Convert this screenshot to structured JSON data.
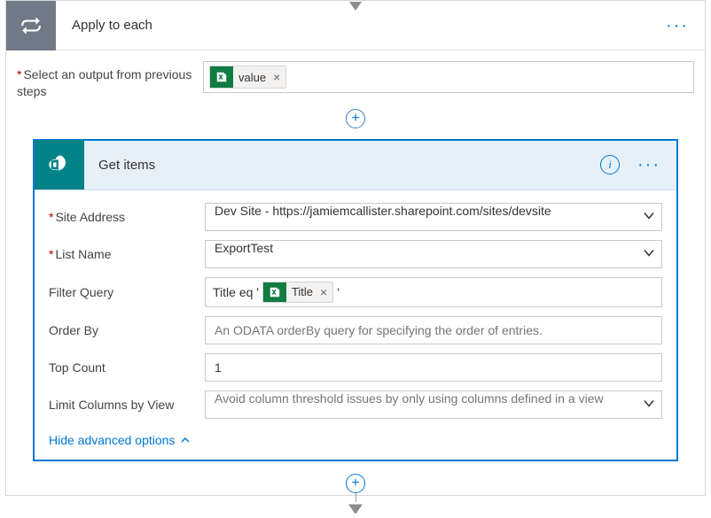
{
  "applyToEach": {
    "title": "Apply to each",
    "pickerLabel": "Select an output from previous steps",
    "token": {
      "label": "value",
      "icon": "excel"
    }
  },
  "getItems": {
    "title": "Get items",
    "fields": {
      "siteAddress": {
        "label": "Site Address",
        "value": "Dev Site - https://jamiemcallister.sharepoint.com/sites/devsite"
      },
      "listName": {
        "label": "List Name",
        "value": "ExportTest"
      },
      "filterQuery": {
        "label": "Filter Query",
        "prefix": "Title eq '",
        "token": {
          "label": "Title",
          "icon": "excel"
        },
        "suffix": "'"
      },
      "orderBy": {
        "label": "Order By",
        "placeholder": "An ODATA orderBy query for specifying the order of entries."
      },
      "topCount": {
        "label": "Top Count",
        "value": "1"
      },
      "limitColumns": {
        "label": "Limit Columns by View",
        "value": "Avoid column threshold issues by only using columns defined in a view"
      }
    },
    "hideAdvanced": "Hide advanced options"
  }
}
